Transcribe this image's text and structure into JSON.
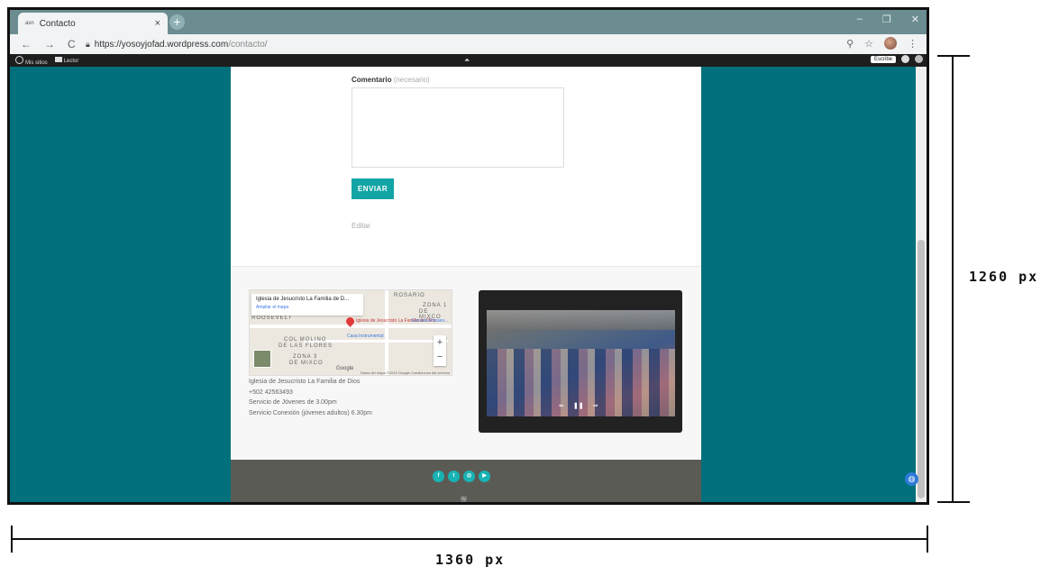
{
  "browser": {
    "tab_title": "Contacto",
    "tab_favicon": "asn",
    "tab_close": "×",
    "newtab": "+",
    "win_min": "–",
    "win_max": "❐",
    "win_close": "✕",
    "nav_back": "←",
    "nav_forward": "→",
    "nav_reload": "C",
    "url_host": "https://yosoyjofad.wordpress.com",
    "url_path": "/contacto/",
    "zoom_icon": "⚲",
    "star_icon": "☆",
    "menu_icon": "⋮"
  },
  "wpbar": {
    "my_sites": "Mis sitios",
    "reader": "Lector",
    "center_icon": "⏶",
    "write": "Escribe"
  },
  "form": {
    "comment_label": "Comentario",
    "comment_required": "(necesario)",
    "send_button": "ENVIAR",
    "edit_link": "Editar"
  },
  "map": {
    "place_title": "Iglesia de Jesucristo La Familia de D...",
    "enlarge_link": "Ampliar el mapa",
    "label_rosario": "ROSARIO",
    "label_roosevelt": "ROOSEVELT",
    "label_zona1": "ZONA 1",
    "label_demixco": "DE MIXCO",
    "label_molino": "COL MOLINO",
    "label_flores": "DE LAS FLORES",
    "label_zona3": "ZONA 3",
    "label_demixco2": "DE MIXCO",
    "pin_label": "Iglesia de Jesucristo La Familia de Dios",
    "casa_label": "Casa Instrumental",
    "escuela_label": "Escuela Roosev...",
    "zoom_in": "+",
    "zoom_out": "−",
    "google": "Google",
    "terms": "Datos del mapa ©2019 Google   Condiciones del servicio"
  },
  "contact_info": {
    "line1": "Iglesia de Jesucristo La Familia de Dios",
    "line2": "+502 42563493",
    "line3": "Servicio de Jóvenes de 3.00pm",
    "line4": "Servicio Conexión (jóvenes adultos) 6.30pm"
  },
  "video": {
    "prev": "⇐",
    "pause": "❚❚",
    "next": "⇒"
  },
  "footer": {
    "social": [
      "f",
      "t",
      "◎",
      "▶"
    ],
    "wp_mark": "Ⓦ",
    "globe": "◍"
  },
  "annotations": {
    "height": "1260 px",
    "width": "1360 px"
  }
}
